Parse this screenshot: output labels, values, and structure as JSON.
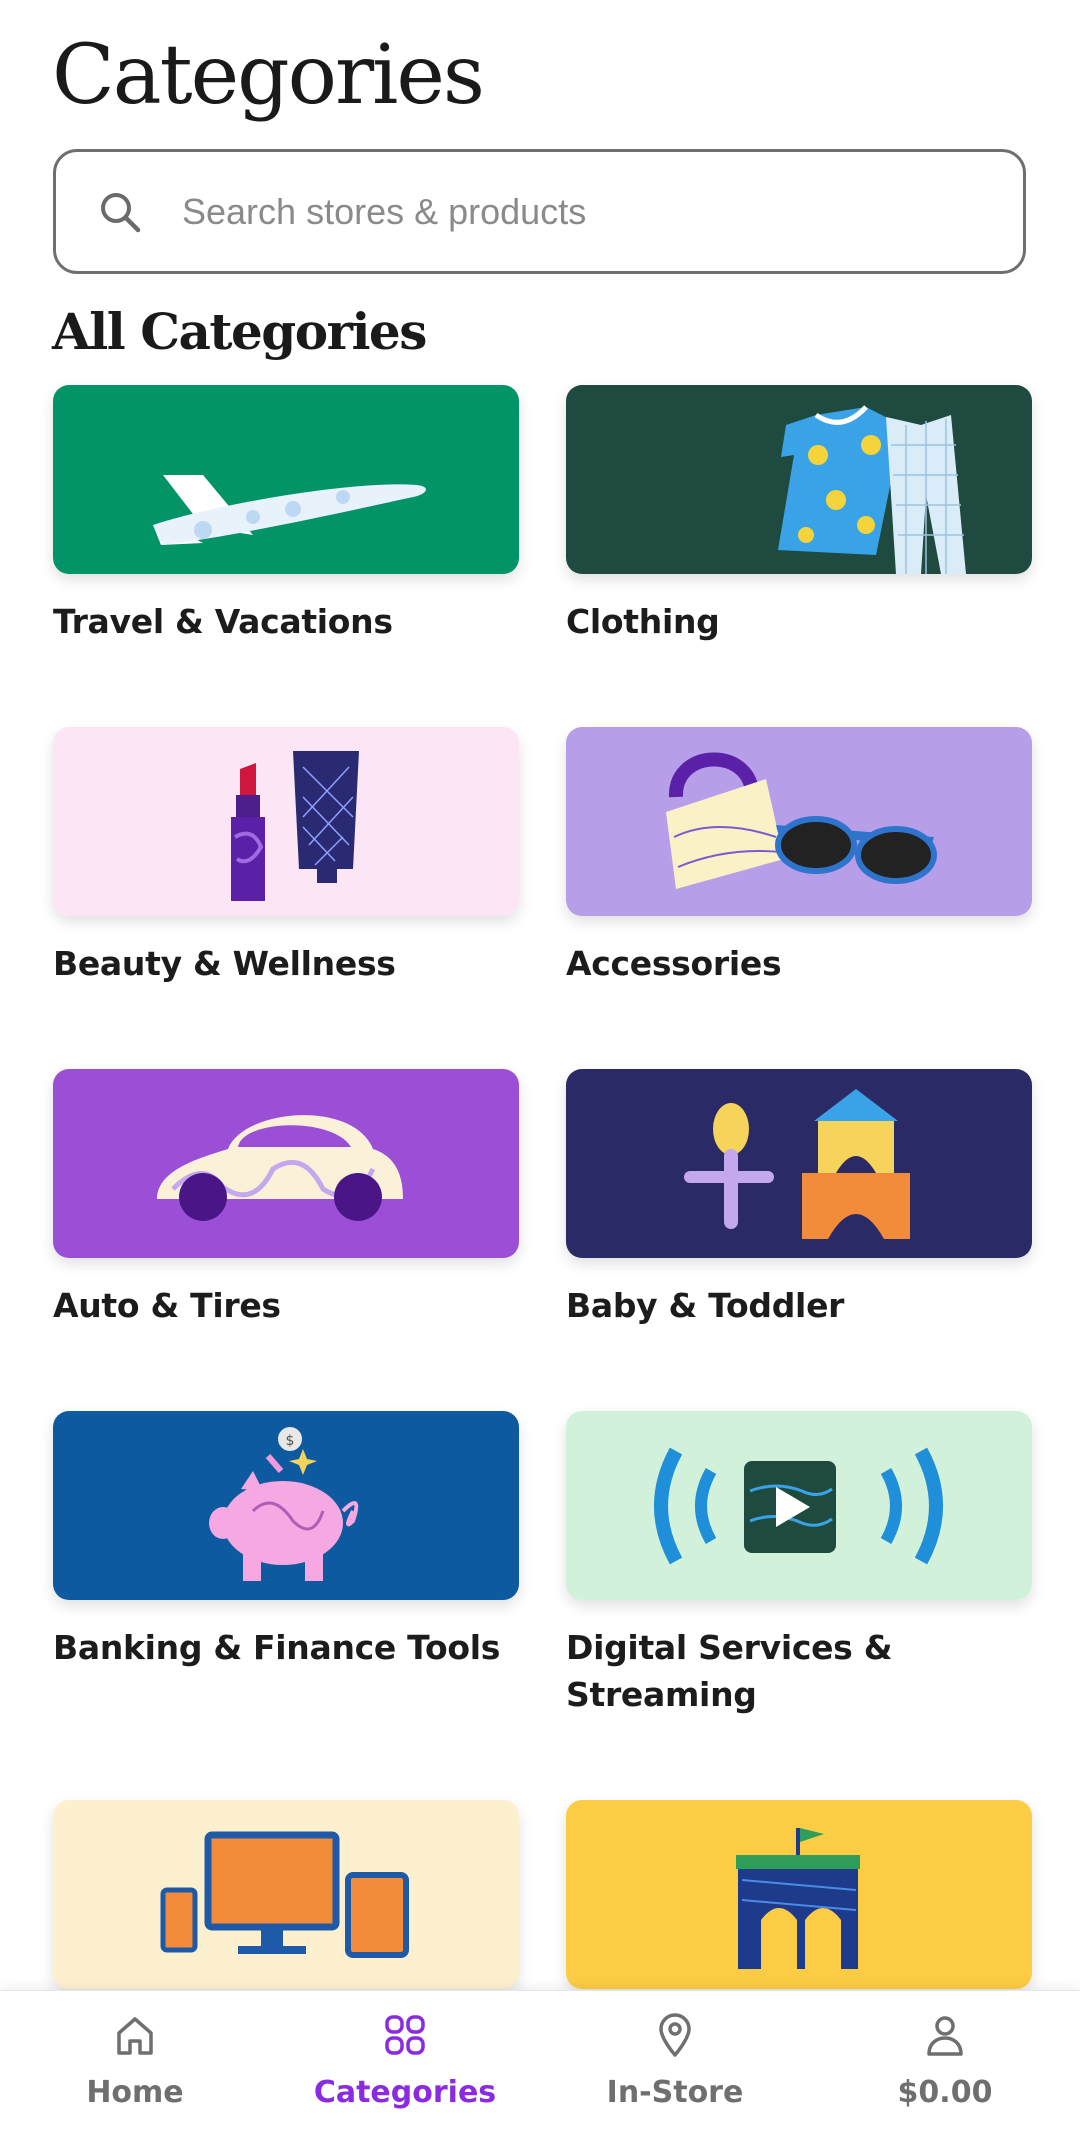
{
  "header": {
    "title": "Categories"
  },
  "search": {
    "placeholder": "Search stores & products",
    "value": ""
  },
  "section": {
    "title": "All Categories"
  },
  "categories": [
    {
      "label": "Travel & Vacations",
      "color": "#029467",
      "icon": "airplane-illustration"
    },
    {
      "label": "Clothing",
      "color": "#1e4a3f",
      "icon": "shirt-and-pants-illustration"
    },
    {
      "label": "Beauty & Wellness",
      "color": "#fce6f6",
      "icon": "lipstick-and-tube-illustration"
    },
    {
      "label": "Accessories",
      "color": "#b69ee8",
      "icon": "bag-and-sunglasses-illustration"
    },
    {
      "label": "Auto & Tires",
      "color": "#9b4fd6",
      "icon": "car-illustration"
    },
    {
      "label": "Baby & Toddler",
      "color": "#2a2a66",
      "icon": "rattle-and-blocks-illustration"
    },
    {
      "label": "Banking & Finance Tools",
      "color": "#0e5aa0",
      "icon": "piggy-bank-illustration"
    },
    {
      "label": "Digital Services & Streaming",
      "color": "#d2f1da",
      "icon": "play-streaming-illustration"
    },
    {
      "label": "",
      "color": "#fcf0cf",
      "icon": "devices-illustration"
    },
    {
      "label": "",
      "color": "#fccc44",
      "icon": "building-illustration"
    }
  ],
  "bottom_nav": {
    "active_color": "#8a2be2",
    "items": [
      {
        "label": "Home",
        "icon": "home-icon"
      },
      {
        "label": "Categories",
        "icon": "grid-icon"
      },
      {
        "label": "In-Store",
        "icon": "location-pin-icon"
      },
      {
        "label": "$0.00",
        "icon": "person-icon"
      }
    ]
  }
}
